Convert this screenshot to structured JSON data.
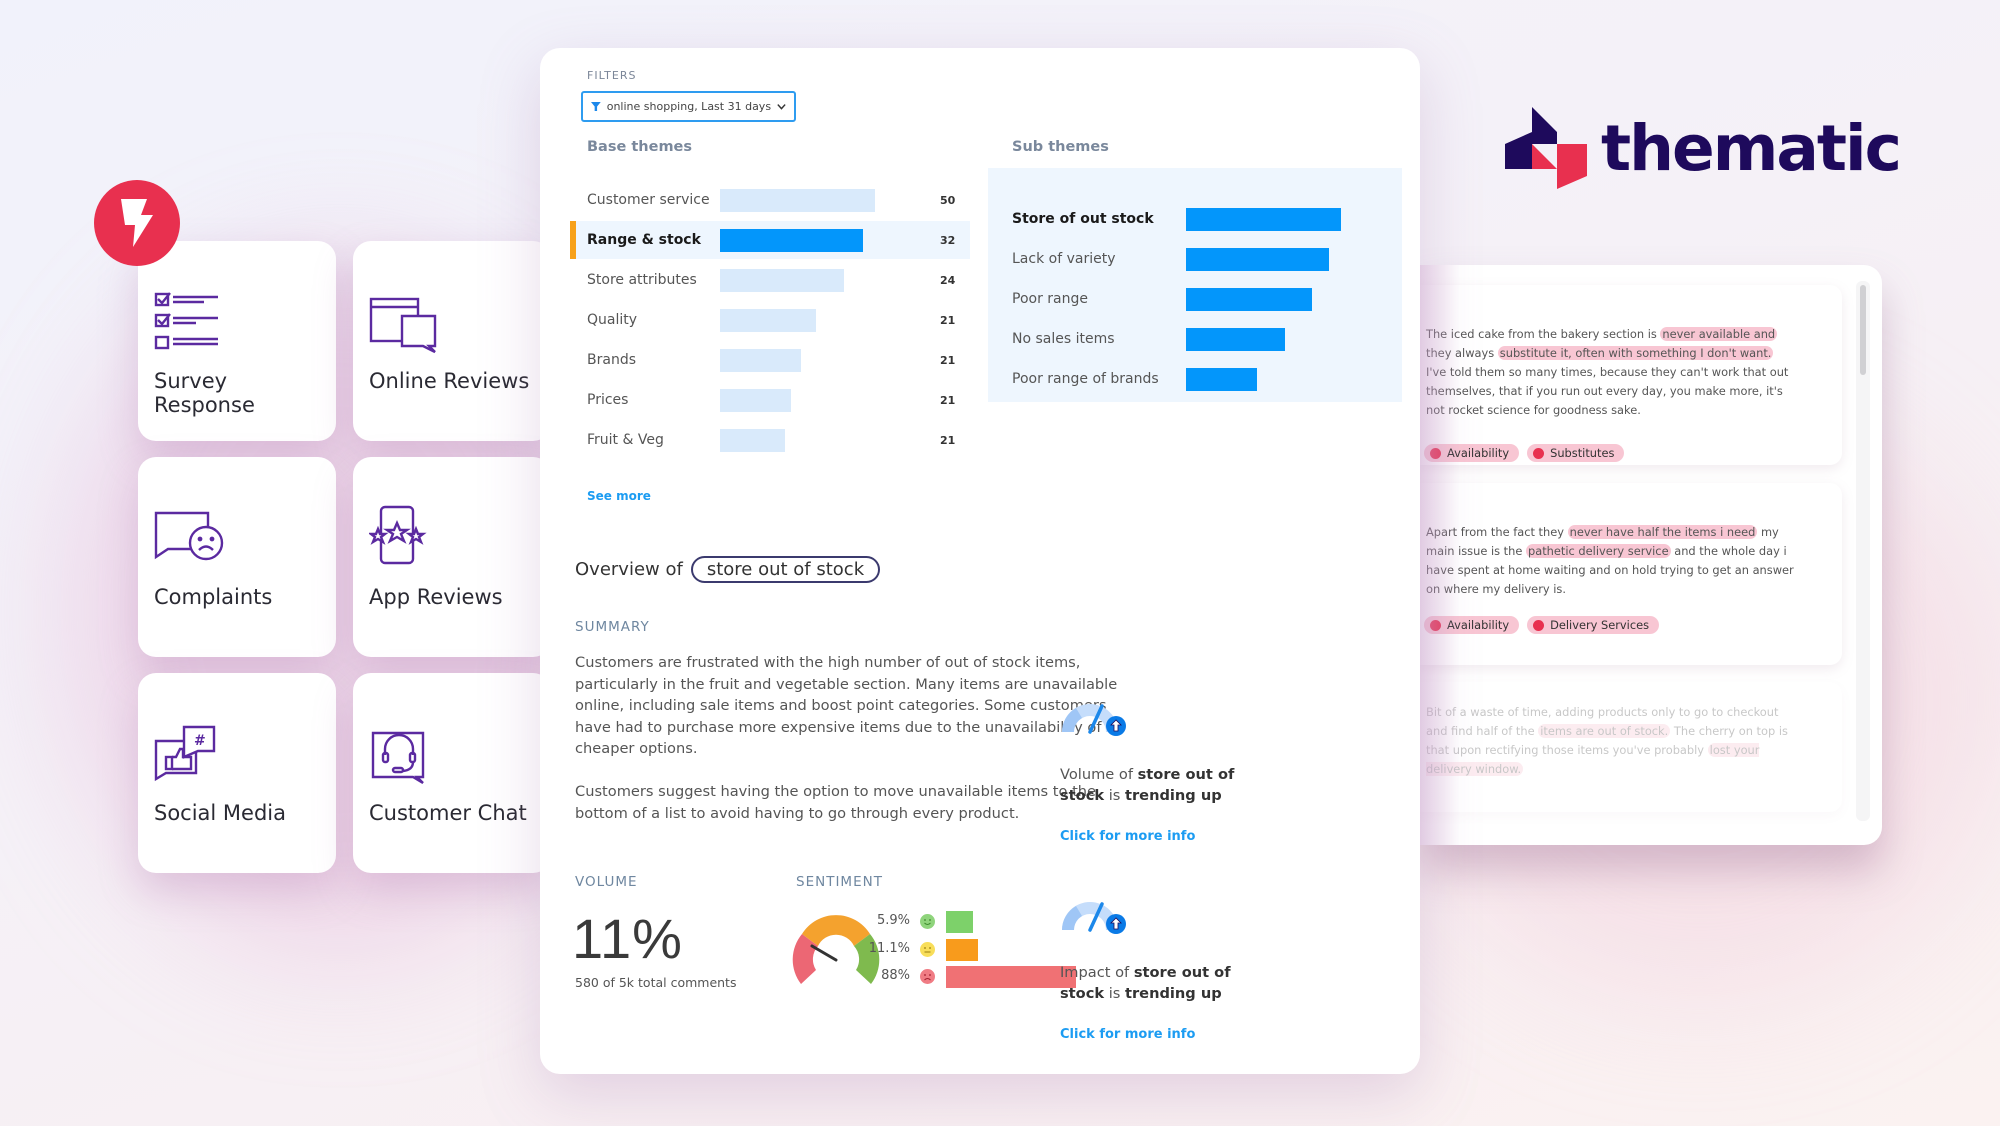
{
  "brand": {
    "name": "thematic",
    "colors": {
      "navy": "#1e0a5c",
      "red": "#e8304f",
      "blue": "#0396fb",
      "orange": "#f7a11a"
    }
  },
  "sources": [
    {
      "label": "Survey Response",
      "icon": "survey-checklist-icon"
    },
    {
      "label": "Online Reviews",
      "icon": "browser-chat-icon"
    },
    {
      "label": "Complaints",
      "icon": "sad-chat-icon"
    },
    {
      "label": "App Reviews",
      "icon": "phone-stars-icon"
    },
    {
      "label": "Social Media",
      "icon": "thumbs-up-hashtag-icon"
    },
    {
      "label": "Customer Chat",
      "icon": "headset-chat-icon"
    }
  ],
  "filters": {
    "label": "FILTERS",
    "selected": "online shopping, Last 31 days"
  },
  "base_themes": {
    "title": "Base themes",
    "items": [
      {
        "name": "Customer service",
        "count": "50",
        "value": 50,
        "selected": false
      },
      {
        "name": "Range & stock",
        "count": "32",
        "value": 46,
        "selected": true
      },
      {
        "name": "Store attributes",
        "count": "24",
        "value": 40,
        "selected": false
      },
      {
        "name": "Quality",
        "count": "21",
        "value": 31,
        "selected": false
      },
      {
        "name": "Brands",
        "count": "21",
        "value": 26,
        "selected": false
      },
      {
        "name": "Prices",
        "count": "21",
        "value": 23,
        "selected": false
      },
      {
        "name": "Fruit & Veg",
        "count": "21",
        "value": 21,
        "selected": false
      }
    ],
    "see_more": "See more"
  },
  "sub_themes": {
    "title": "Sub themes",
    "items": [
      {
        "name": "Store of out stock",
        "value": 100,
        "selected": true
      },
      {
        "name": "Lack of variety",
        "value": 92,
        "selected": false
      },
      {
        "name": "Poor range",
        "value": 81,
        "selected": false
      },
      {
        "name": "No sales items",
        "value": 64,
        "selected": false
      },
      {
        "name": "Poor range of brands",
        "value": 46,
        "selected": false
      }
    ]
  },
  "overview": {
    "prefix": "Overview of",
    "theme": "store out of stock",
    "summary_label": "SUMMARY",
    "summary_paragraphs": [
      "Customers are frustrated with the high number of out of stock items, particularly in the fruit and vegetable section. Many items are unavailable online, including sale items and boost point categories. Some customers have had to purchase more expensive items due to the unavailability of cheaper options.",
      "Customers suggest having the option to move unavailable items to the bottom of a list to avoid having to go through every product."
    ]
  },
  "volume": {
    "label": "VOLUME",
    "value": "11%",
    "detail": "580 of 5k total comments"
  },
  "sentiment": {
    "label": "SENTIMENT",
    "rows": [
      {
        "pct": "5.9%",
        "value": 5.9,
        "face": "happy",
        "color": "#7dd16a"
      },
      {
        "pct": "11.1%",
        "value": 11.1,
        "face": "neutral",
        "color": "#f89b1c"
      },
      {
        "pct": "88%",
        "value": 88,
        "face": "sad",
        "color": "#f07174"
      }
    ]
  },
  "trends": [
    {
      "metric": "Volume of",
      "subject": "store out of",
      "subject2": "stock",
      "is": "is",
      "trend": "trending up",
      "link": "Click for more info"
    },
    {
      "metric": "Impact of",
      "subject": "store out of",
      "subject2": "stock",
      "is": "is",
      "trend": "trending up",
      "link": "Click for more info"
    }
  ],
  "comments": [
    {
      "segments": [
        {
          "t": "The iced cake from the bakery section is ",
          "hl": false
        },
        {
          "t": "never available and",
          "hl": true
        },
        {
          "t": " they always ",
          "hl": false
        },
        {
          "t": "substitute it, often with something I don't want.",
          "hl": true
        },
        {
          "t": " I've told them so many times, because they can't work that out themselves, that if you run out every day, you make more, it's not rocket science for goodness sake.",
          "hl": false
        }
      ],
      "tags": [
        "Availability",
        "Substitutes"
      ]
    },
    {
      "segments": [
        {
          "t": "Apart from the fact they ",
          "hl": false
        },
        {
          "t": "never have half the items i need",
          "hl": true
        },
        {
          "t": " my main issue is the ",
          "hl": false
        },
        {
          "t": "pathetic delivery service",
          "hl": true
        },
        {
          "t": " and the whole day i have spent at home waiting and on hold trying to get an answer on where my delivery is.",
          "hl": false
        }
      ],
      "tags": [
        "Availability",
        "Delivery Services"
      ]
    },
    {
      "segments": [
        {
          "t": "Bit of a waste of time, adding products only to go to checkout and find half of the ",
          "hl": false
        },
        {
          "t": "items are out of stock.",
          "hl": true
        },
        {
          "t": " The cherry on top is that upon rectifying those items you've probably ",
          "hl": false
        },
        {
          "t": "lost your delivery window.",
          "hl": true
        }
      ],
      "tags": []
    }
  ]
}
